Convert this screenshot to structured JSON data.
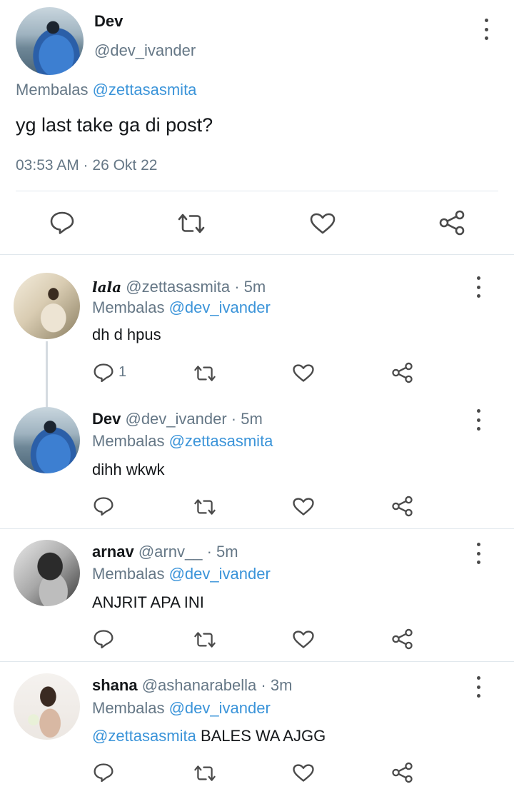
{
  "main": {
    "name": "Dev",
    "handle": "@dev_ivander",
    "reply_prefix": "Membalas ",
    "reply_to": "@zettasasmita",
    "text": "yg last take ga di post?",
    "timestamp": "03:53 AM · 26 Okt 22"
  },
  "replies": [
    {
      "name": "lala",
      "handle": "@zettasasmita",
      "time": " · 5m",
      "reply_prefix": "Membalas ",
      "reply_to": "@dev_ivander",
      "text": "dh d hpus",
      "reply_count": "1"
    },
    {
      "name": "Dev",
      "handle": "@dev_ivander",
      "time": " · 5m",
      "reply_prefix": "Membalas ",
      "reply_to": "@zettasasmita",
      "text": "dihh wkwk"
    },
    {
      "name": "arnav",
      "handle": "@arnv__",
      "time": " · 5m",
      "reply_prefix": "Membalas ",
      "reply_to": "@dev_ivander",
      "text": "ANJRIT APA INI"
    },
    {
      "name": "shana",
      "handle": "@ashanarabella",
      "time": " · 3m",
      "reply_prefix": "Membalas ",
      "reply_to": "@dev_ivander",
      "text_mention": "@zettasasmita",
      "text": " BALES WA AJGG"
    }
  ],
  "colors": {
    "link": "#3b94d9",
    "secondary": "#657786",
    "divider": "#e1e8ed"
  },
  "icons": [
    "reply-icon",
    "retweet-icon",
    "like-icon",
    "share-icon",
    "more-icon"
  ]
}
